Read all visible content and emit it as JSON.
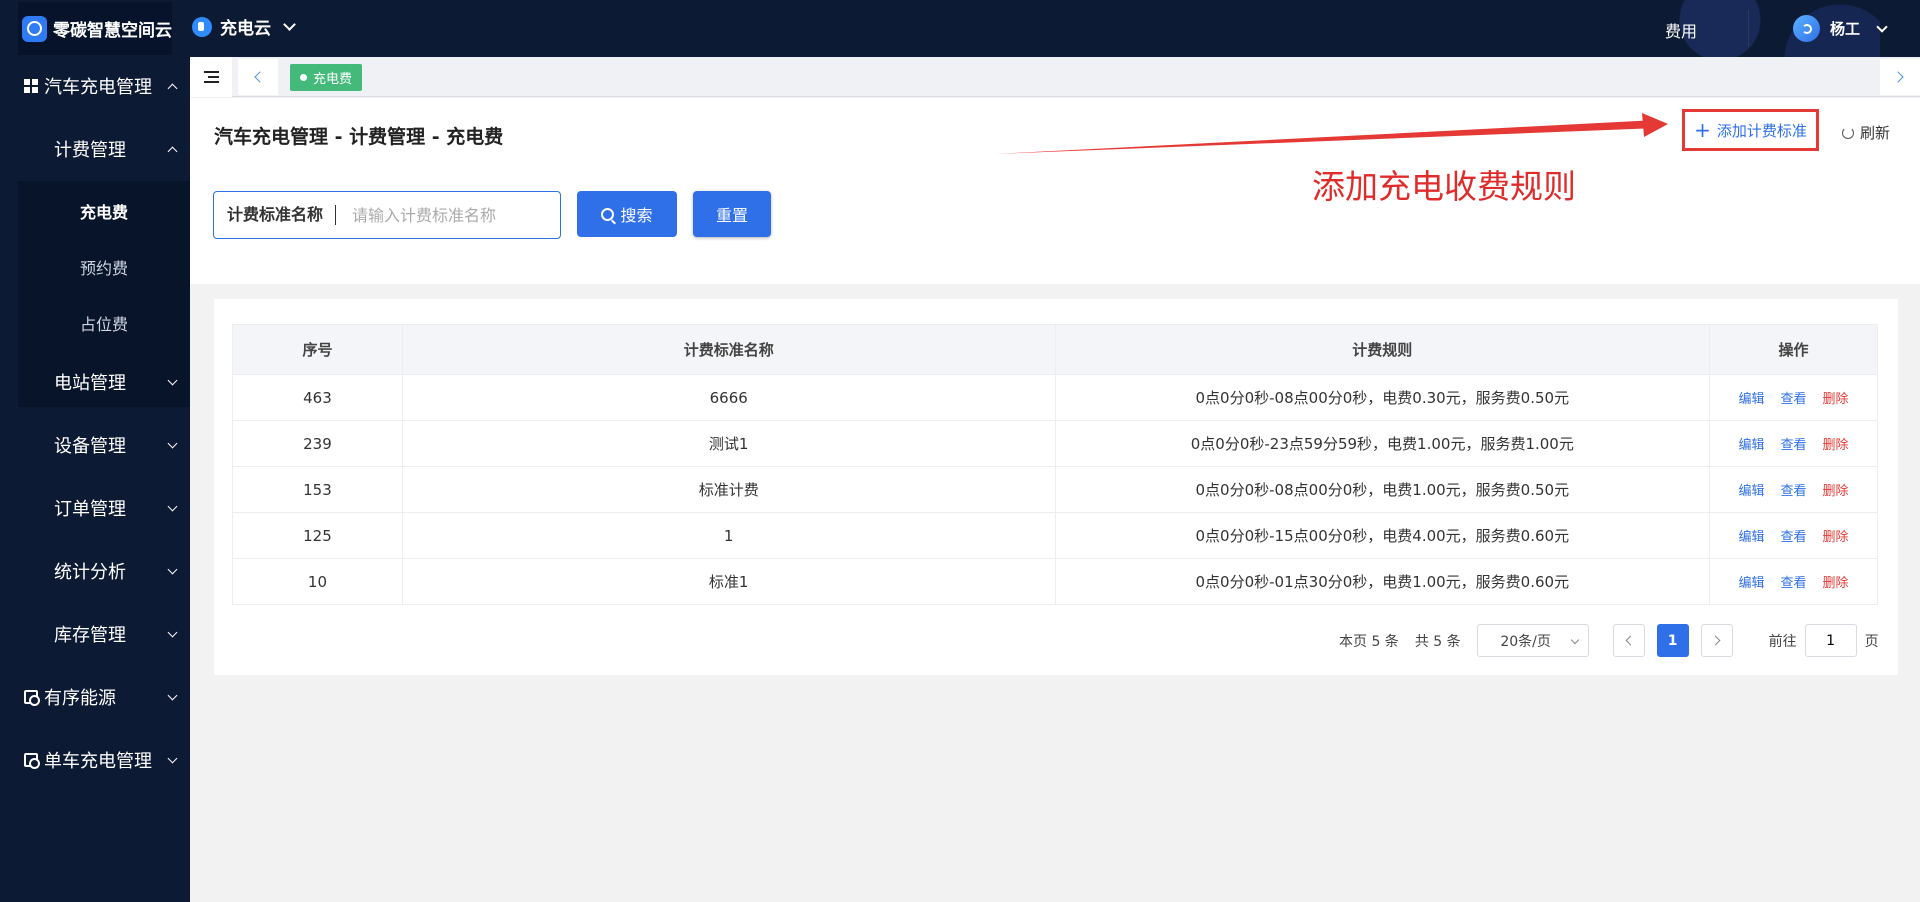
{
  "topbar": {
    "brand": "零碳智慧空间云",
    "app_name": "充电云",
    "fee_link": "费用",
    "user_name": "杨工"
  },
  "sidebar": {
    "group_ev": "汽车充电管理",
    "sub_billing": "计费管理",
    "billing_items": [
      "充电费",
      "预约费",
      "占位费"
    ],
    "station": "电站管理",
    "device": "设备管理",
    "order": "订单管理",
    "stats": "统计分析",
    "inventory": "库存管理",
    "ordered_energy": "有序能源",
    "bike": "单车充电管理"
  },
  "tabs": {
    "active_tab": "充电费"
  },
  "header": {
    "title": "汽车充电管理 - 计费管理 - 充电费",
    "add_button": "添加计费标准",
    "refresh": "刷新",
    "annotation": "添加充电收费规则"
  },
  "search": {
    "label": "计费标准名称",
    "placeholder": "请输入计费标准名称",
    "search_button": "搜索",
    "reset_button": "重置"
  },
  "table": {
    "columns": [
      "序号",
      "计费标准名称",
      "计费规则",
      "操作"
    ],
    "actions": {
      "edit": "编辑",
      "view": "查看",
      "delete": "删除"
    },
    "rows": [
      {
        "id": "463",
        "name": "6666",
        "rule": "0点0分0秒-08点00分0秒，电费0.30元，服务费0.50元"
      },
      {
        "id": "239",
        "name": "测试1",
        "rule": "0点0分0秒-23点59分59秒，电费1.00元，服务费1.00元"
      },
      {
        "id": "153",
        "name": "标准计费",
        "rule": "0点0分0秒-08点00分0秒，电费1.00元，服务费0.50元"
      },
      {
        "id": "125",
        "name": "1",
        "rule": "0点0分0秒-15点00分0秒，电费4.00元，服务费0.60元"
      },
      {
        "id": "10",
        "name": "标准1",
        "rule": "0点0分0秒-01点30分0秒，电费1.00元，服务费0.60元"
      }
    ]
  },
  "pagination": {
    "page_count_text": "本页 5 条",
    "total_text": "共 5 条",
    "page_size": "20条/页",
    "current_page": "1",
    "goto_label": "前往",
    "goto_value": "1",
    "page_suffix": "页"
  },
  "colors": {
    "nav_bg": "#0d1a33",
    "primary": "#2f6fe8",
    "annotation_red": "#e53935",
    "tab_green": "#43b97a"
  }
}
